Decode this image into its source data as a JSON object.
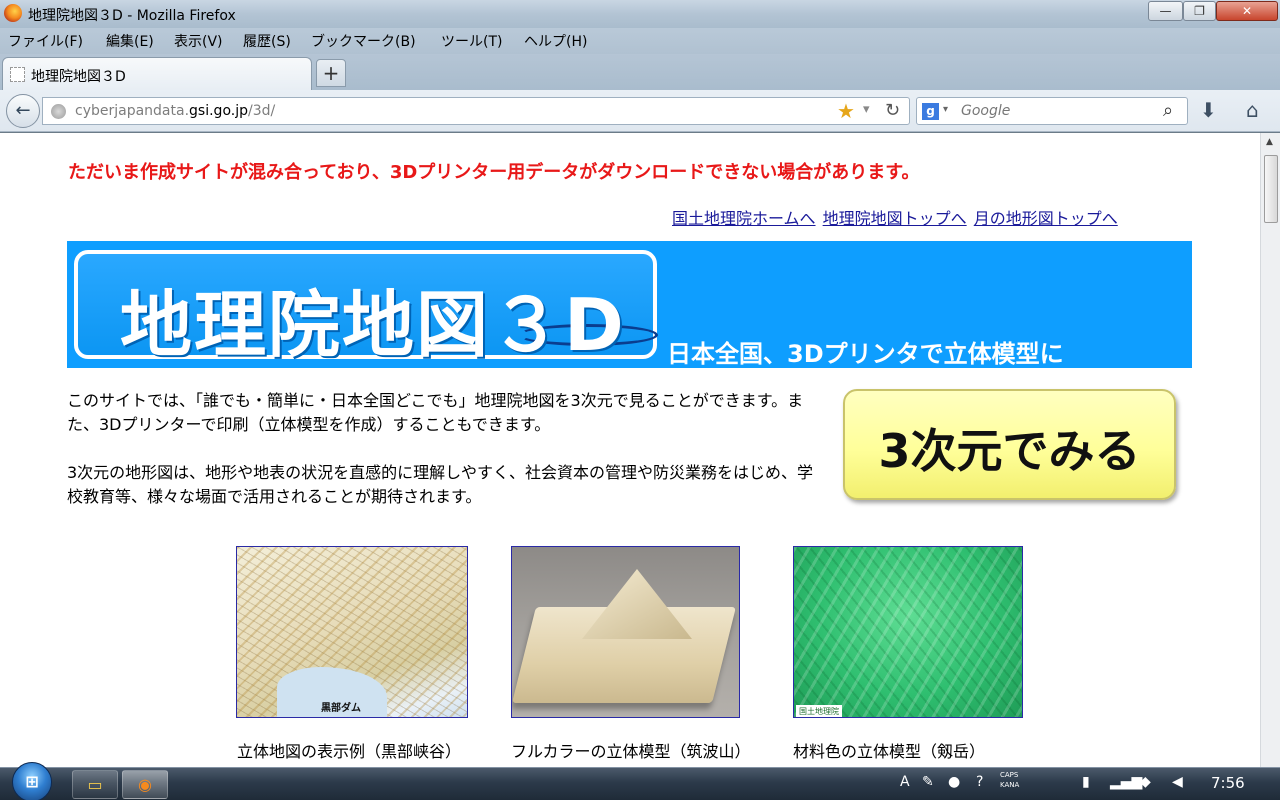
{
  "window": {
    "title": "地理院地図３D - Mozilla Firefox",
    "minimize_icon": "—",
    "maximize_icon": "❐",
    "close_icon": "✕"
  },
  "menu": [
    "ファイル(F)",
    "編集(E)",
    "表示(V)",
    "履歴(S)",
    "ブックマーク(B)",
    "ツール(T)",
    "ヘルプ(H)"
  ],
  "tab": {
    "title": "地理院地図３D",
    "new_tab_icon": "+"
  },
  "nav": {
    "back_icon": "←",
    "url_prefix": "cyberjapandata.",
    "url_domain": "gsi.go.jp",
    "url_path": "/3d/",
    "star_icon": "★",
    "dropdown_icon": "▾",
    "reload_icon": "↻",
    "search_engine_icon": "g",
    "search_dropdown_icon": "▾",
    "search_placeholder": "Google",
    "search_icon": "⌕",
    "download_icon": "⬇",
    "home_icon": "⌂"
  },
  "page": {
    "notice": "ただいま作成サイトが混み合っており、3Dプリンター用データがダウンロードできない場合があります。",
    "links": [
      "国土地理院ホームへ",
      "地理院地図トップへ",
      "月の地形図トップへ"
    ],
    "banner": {
      "logo_text": "地理院地図３D",
      "tagline": "日本全国、3Dプリンタで立体模型に"
    },
    "desc1": "このサイトでは、「誰でも・簡単に・日本全国どこでも」地理院地図を3次元で見ることができます。また、3Dプリンターで印刷（立体模型を作成）することもできます。",
    "desc2": "3次元の地形図は、地形や地表の状況を直感的に理解しやすく、社会資本の管理や防災業務をはじめ、学校教育等、様々な場面で活用されることが期待されます。",
    "button": "3次元でみる",
    "figures": [
      {
        "caption": "立体地図の表示例（黒部峡谷）",
        "image_label": "黒部ダム"
      },
      {
        "caption": "フルカラーの立体模型（筑波山）"
      },
      {
        "caption": "材料色の立体模型（剱岳）",
        "image_label": "国土地理院"
      }
    ]
  },
  "taskbar": {
    "start_icon": "windows-orb",
    "caps": "CAPS",
    "kana": "KANA",
    "clock": "7:56"
  }
}
